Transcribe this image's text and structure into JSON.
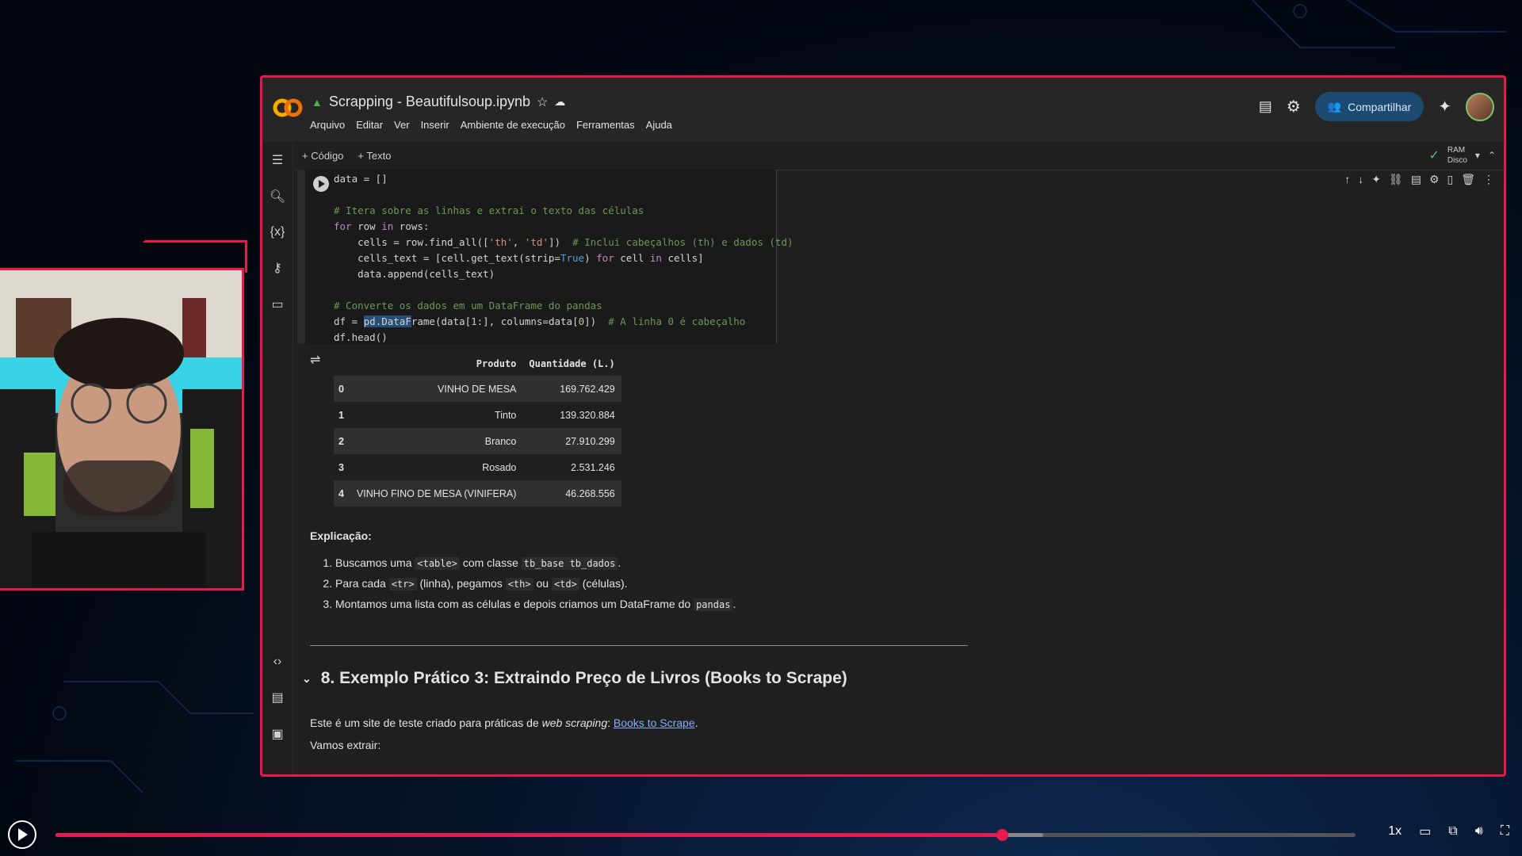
{
  "notebook": {
    "title": "Scrapping - Beautifulsoup.ipynb",
    "menu": [
      "Arquivo",
      "Editar",
      "Ver",
      "Inserir",
      "Ambiente de execução",
      "Ferramentas",
      "Ajuda"
    ],
    "share_label": "Compartilhar",
    "add_code_label": "+ Código",
    "add_text_label": "+ Texto",
    "ram_label": "RAM",
    "disk_label": "Disco"
  },
  "code_lines": [
    "data = []",
    "",
    "# Itera sobre as linhas e extrai o texto das células",
    "for row in rows:",
    "    cells = row.find_all(['th', 'td'])  # Inclui cabeçalhos (th) e dados (td)",
    "    cells_text = [cell.get_text(strip=True) for cell in cells]",
    "    data.append(cells_text)",
    "",
    "# Converte os dados em um DataFrame do pandas",
    "df = pd.DataFrame(data[1:], columns=data[0])  # A linha 0 é cabeçalho",
    "df.head()"
  ],
  "output": {
    "columns": [
      "",
      "Produto",
      "Quantidade (L.)"
    ],
    "rows": [
      [
        "0",
        "VINHO DE MESA",
        "169.762.429"
      ],
      [
        "1",
        "Tinto",
        "139.320.884"
      ],
      [
        "2",
        "Branco",
        "27.910.299"
      ],
      [
        "3",
        "Rosado",
        "2.531.246"
      ],
      [
        "4",
        "VINHO FINO DE MESA (VINIFERA)",
        "46.268.556"
      ]
    ]
  },
  "explanation": {
    "heading": "Explicação:",
    "item1_a": "Buscamos uma ",
    "item1_code1": "<table>",
    "item1_b": " com classe ",
    "item1_code2": "tb_base tb_dados",
    "item1_c": ".",
    "item2_a": "Para cada ",
    "item2_code1": "<tr>",
    "item2_b": " (linha), pegamos ",
    "item2_code2": "<th>",
    "item2_c": " ou ",
    "item2_code3": "<td>",
    "item2_d": " (células).",
    "item3_a": "Montamos uma lista com as células e depois criamos um DataFrame do ",
    "item3_code": "pandas",
    "item3_b": "."
  },
  "section": {
    "title": "8. Exemplo Prático 3: Extraindo Preço de Livros (Books to Scrape)",
    "para_a": "Este é um site de teste criado para práticas de ",
    "para_em": "web scraping",
    "para_b": ": ",
    "link": "Books to Scrape",
    "para_c": ".",
    "line2": "Vamos extrair:"
  },
  "player": {
    "speed": "1x",
    "progress": 0.728,
    "buffered": 0.76
  },
  "colors": {
    "accent": "#e8194f",
    "share_bg": "#1d4a70"
  }
}
